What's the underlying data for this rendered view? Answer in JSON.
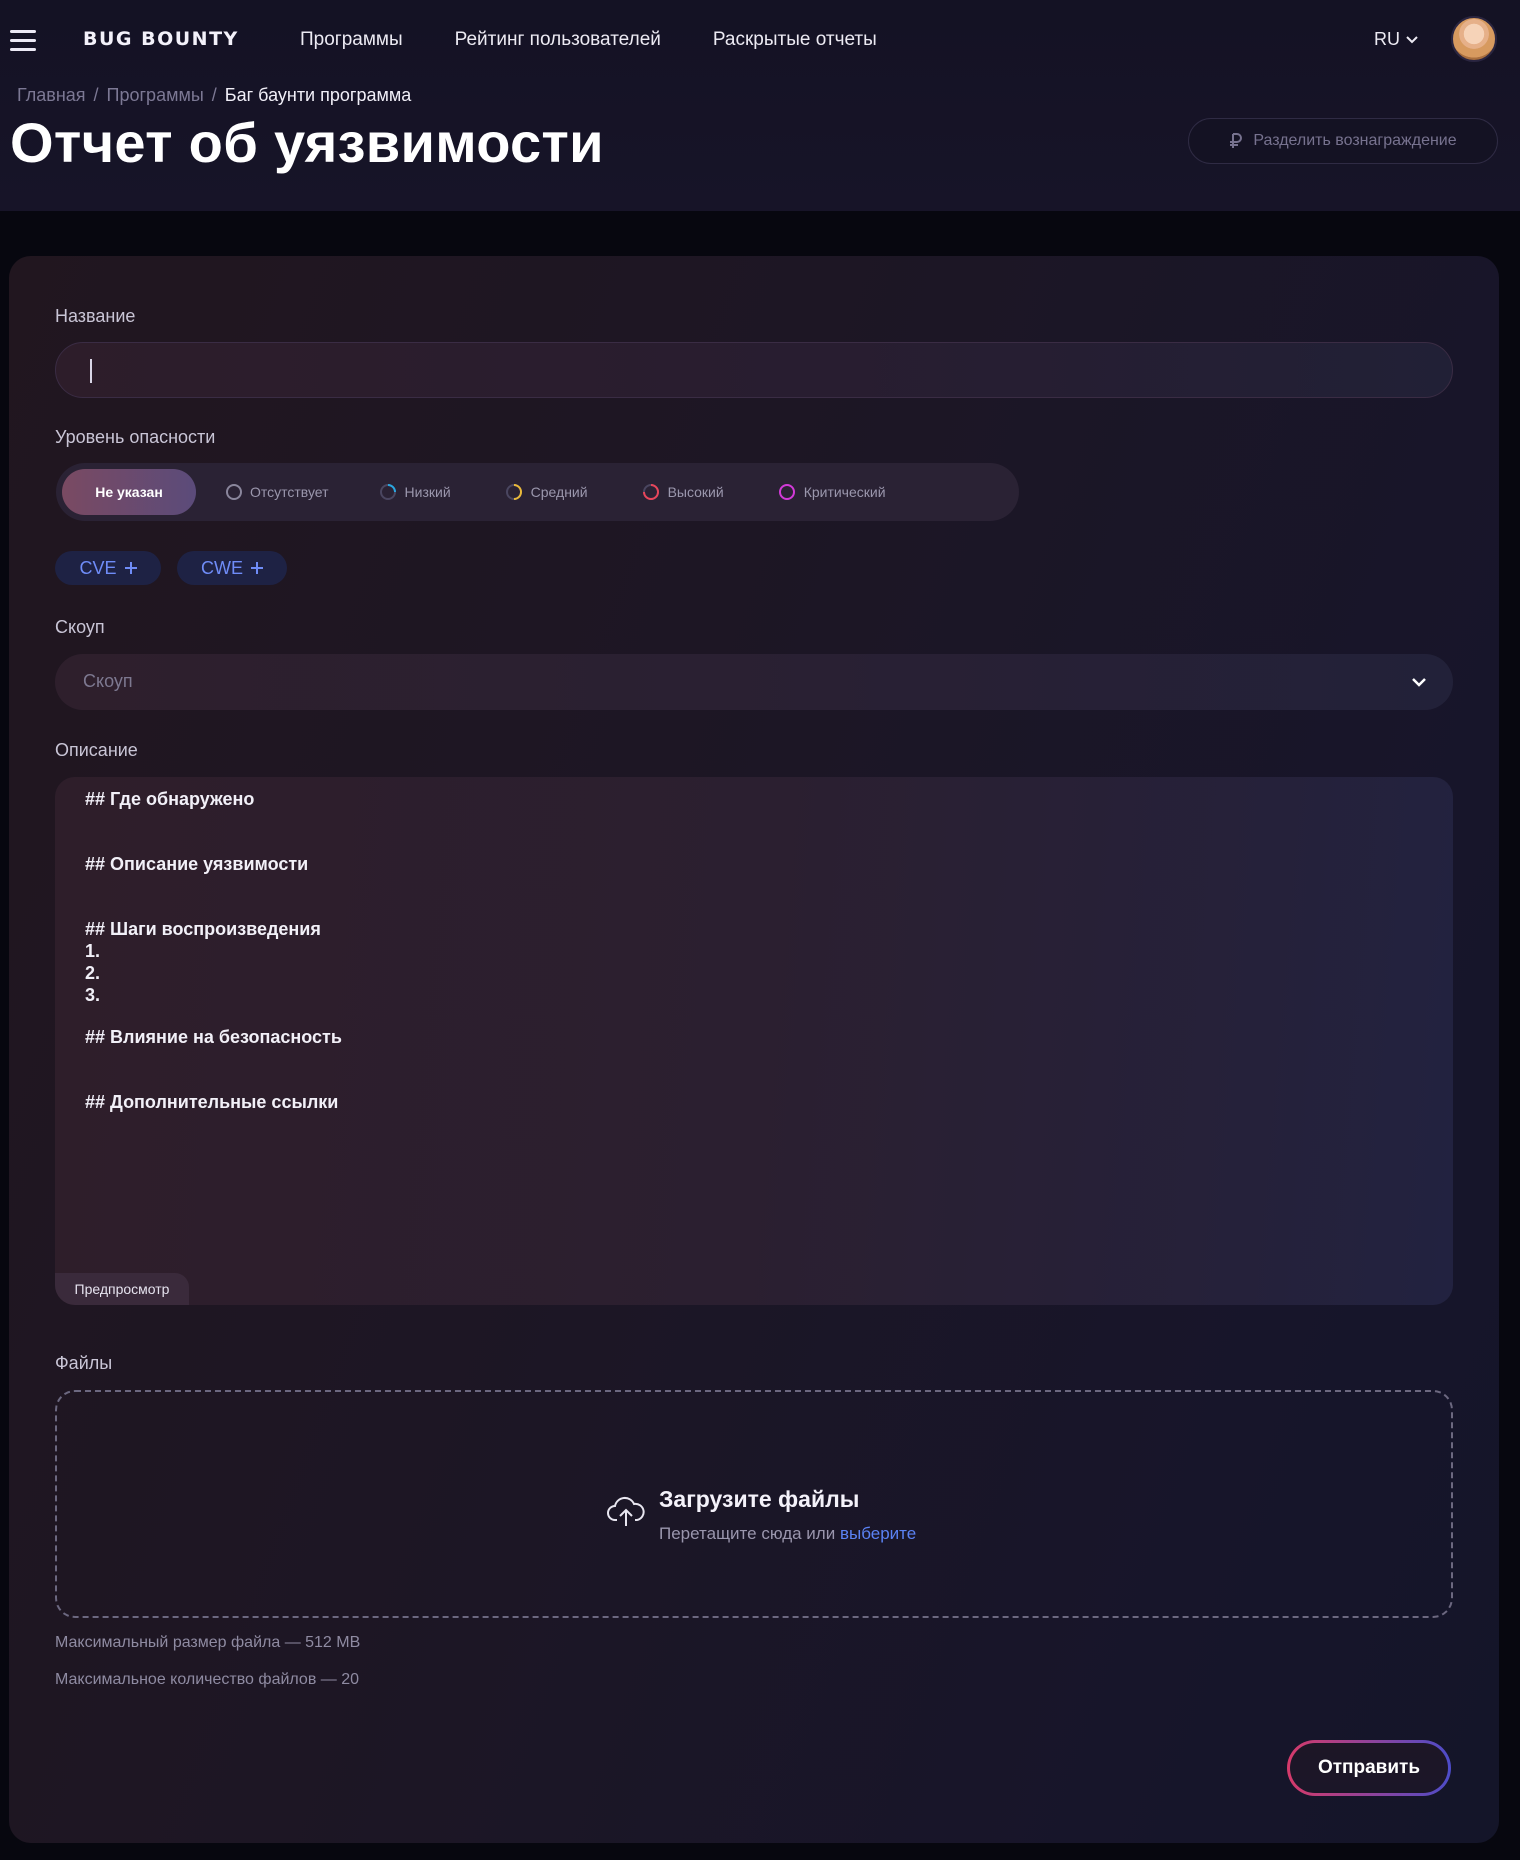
{
  "header": {
    "logo": "BUG BOUNTY",
    "nav": [
      "Программы",
      "Рейтинг пользователей",
      "Раскрытые отчеты"
    ],
    "language": "RU"
  },
  "breadcrumb": [
    "Главная",
    "Программы",
    "Баг баунти программа"
  ],
  "page_title": "Отчет об уязвимости",
  "share_reward_button": "Разделить вознаграждение",
  "form": {
    "title_label": "Название",
    "title_value": "",
    "severity_label": "Уровень опасности",
    "severity_options": [
      {
        "label": "Не указан",
        "active": true
      },
      {
        "label": "Отсутствует",
        "color": "#7f7b91"
      },
      {
        "label": "Низкий",
        "color": "#29a7e0"
      },
      {
        "label": "Средний",
        "color": "#e9b93a"
      },
      {
        "label": "Высокий",
        "color": "#e8455a"
      },
      {
        "label": "Критический",
        "color": "#d23ad8"
      }
    ],
    "cve_button": "CVE",
    "cwe_button": "CWE",
    "scope_label": "Скоуп",
    "scope_placeholder": "Скоуп",
    "description_label": "Описание",
    "description_lines": [
      "## Где обнаружено",
      "## Описание уязвимости",
      "## Шаги воспроизведения",
      "1.",
      "2.",
      "3.",
      "## Влияние на безопасность",
      "## Дополнительные ссылки"
    ],
    "preview_tab": "Предпросмотр",
    "files_label": "Файлы",
    "upload_title": "Загрузите файлы",
    "upload_hint": "Перетащите сюда или",
    "upload_link": "выберите",
    "max_size_note": "Максимальный размер файла — 512 MB",
    "max_count_note": "Максимальное количество файлов — 20",
    "submit_button": "Отправить"
  }
}
